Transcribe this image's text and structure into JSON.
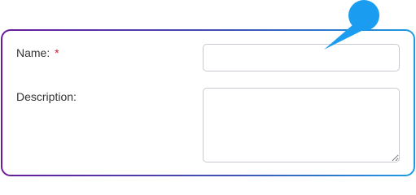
{
  "form": {
    "name": {
      "label": "Name:",
      "required_marker": "*",
      "value": "",
      "placeholder": ""
    },
    "description": {
      "label": "Description:",
      "value": "",
      "placeholder": ""
    }
  },
  "colors": {
    "frame_gradient_start": "#6a1b9a",
    "frame_gradient_end": "#1e9be0",
    "pointer": "#1a9cf0",
    "required": "#d11a2a"
  },
  "icons": {
    "pointer": "callout-pointer-icon"
  }
}
